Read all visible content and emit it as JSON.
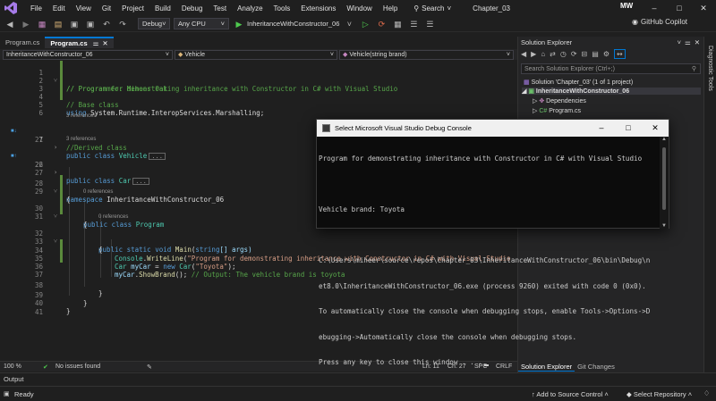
{
  "menubar": {
    "items": [
      "File",
      "Edit",
      "View",
      "Git",
      "Project",
      "Build",
      "Debug",
      "Test",
      "Analyze",
      "Tools",
      "Extensions",
      "Window",
      "Help"
    ],
    "search_label": "Search",
    "solution_name": "Chapter_03",
    "avatar_initials": "MW"
  },
  "toolbar": {
    "config": "Debug",
    "platform": "Any CPU",
    "run_target": "InheritanceWithConstructor_06",
    "copilot": "GitHub Copilot"
  },
  "tabs": [
    {
      "label": "Program.cs",
      "active": false
    },
    {
      "label": "Program.cs",
      "active": true
    }
  ],
  "navbar": {
    "project": "InheritanceWithConstructor_06",
    "type": "Vehicle",
    "member": "Vehicle(string brand)"
  },
  "editor": {
    "lines": [
      {
        "n": "1",
        "html": "comment1"
      },
      {
        "n": "2"
      },
      {
        "n": "3"
      },
      {
        "n": "4"
      },
      {
        "n": "5"
      },
      {
        "n": "6"
      },
      {
        "n": "7"
      },
      {
        "n": "21"
      },
      {
        "n": "22"
      },
      {
        "n": "26"
      },
      {
        "n": "27"
      },
      {
        "n": "28"
      },
      {
        "n": "29"
      },
      {
        "n": "30"
      },
      {
        "n": "31"
      },
      {
        "n": "32"
      },
      {
        "n": "33"
      },
      {
        "n": "34"
      },
      {
        "n": "35"
      },
      {
        "n": "36"
      },
      {
        "n": "37"
      },
      {
        "n": "38"
      },
      {
        "n": "39"
      },
      {
        "n": "40"
      },
      {
        "n": "41"
      }
    ],
    "text": {
      "l1": "// Program for demonstrating inheritance with Constructor in C# with Visual Studio",
      "l2": "// Programmer: Miheer Oak",
      "l4": "// Base class",
      "l5_using": "using",
      "l5_ns": " System.Runtime.InteropServices.Marshalling;",
      "refs3": "3 references",
      "l7_kw": "public class",
      "l7_type": "Vehicle",
      "l21": "//Derived class",
      "l22_kw": "public class",
      "l22_type": "Car",
      "l22_base": "Vehicle",
      "l28_kw": "namespace",
      "l28_name": "InheritanceWithConstructor_06",
      "l29": "{",
      "refs0": "0 references",
      "l30_kw": "public class",
      "l30_type": "Program",
      "l31": "{",
      "l32_kw": "public static void",
      "l32_method": "Main",
      "l32_args_type": "string",
      "l32_args": "[] args)",
      "l33": "{",
      "l34_type": "Console",
      "l34_method": "WriteLine",
      "l34_str": "\"Program for demonstrating inheritance with Constructor in C# with Visual Studio",
      "l35_type": "Car",
      "l35_var": "myCar",
      "l35_kw": "new",
      "l35_type2": "Car",
      "l35_str": "\"Toyota\"",
      "l36_var": "myCar",
      "l36_method": "ShowBrand",
      "l36_comment": "// Output: The vehicle brand is toyota",
      "l38": "}",
      "l39": "}",
      "l40": "}",
      "ellipsis": "..."
    }
  },
  "editor_status": {
    "zoom": "100 %",
    "issues": "No issues found",
    "line": "Ln: 11",
    "col": "Ch: 27",
    "spc": "SPC",
    "crlf": "CRLF"
  },
  "solution_explorer": {
    "title": "Solution Explorer",
    "search_placeholder": "Search Solution Explorer (Ctrl+;)",
    "solution": "Solution 'Chapter_03' (1 of 1 project)",
    "project": "InheritanceWithConstructor_06",
    "dependencies": "Dependencies",
    "program": "Program.cs",
    "tab_solexp": "Solution Explorer",
    "tab_git": "Git Changes"
  },
  "diagnostic_tools": "Diagnostic Tools",
  "output_tab": "Output",
  "statusbar": {
    "ready": "Ready",
    "source_control": "Add to Source Control",
    "repository": "Select Repository"
  },
  "console": {
    "title": "Select Microsoft Visual Studio Debug Console",
    "lines": [
      "Program for demonstrating inheritance with Constructor in C# with Visual Studio",
      "",
      "Vehicle brand: Toyota",
      "",
      "C:\\Users\\miheer\\source\\repos\\Chapter_03\\InheritanceWithConstructor_06\\bin\\Debug\\n",
      "et8.0\\InheritanceWithConstructor_06.exe (process 9260) exited with code 0 (0x0).",
      "To automatically close the console when debugging stops, enable Tools->Options->D",
      "ebugging->Automatically close the console when debugging stops.",
      "Press any key to close this window . . ."
    ]
  }
}
